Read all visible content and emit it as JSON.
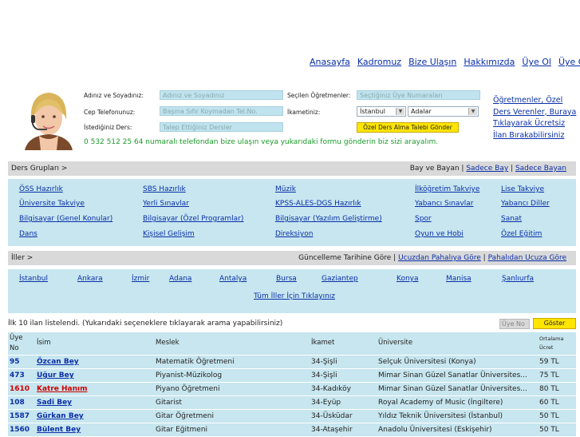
{
  "nav": [
    "Anasayfa",
    "Kadromuz",
    "Bize Ulaşın",
    "Hakkımızda",
    "Üye Ol",
    "Üye Girişi"
  ],
  "form": {
    "name_label": "Adınız ve Soyadınız:",
    "name_placeholder": "Adınız ve Soyadınız",
    "phone_label": "Cep Telefonunuz:",
    "phone_placeholder": "Başına Sıfır Koymadan Tel.No.",
    "lesson_label": "İstediğiniz Ders:",
    "lesson_placeholder": "Talep Ettiğiniz Dersler",
    "teachers_label": "Seçilen Öğretmenler:",
    "teachers_placeholder": "Seçtiğiniz Üye Numaraları",
    "residence_label": "İkametiniz:",
    "city": "İstanbul",
    "district": "Adalar",
    "submit": "Özel Ders Alma Talebi Gönder",
    "phone_note": "0 532 512 25 64 numaralı telefondan bize ulaşın veya yukarıdaki formu gönderin biz sizi arayalım."
  },
  "sidelink": "Öğretmenler, Özel Ders Verenler, Buraya Tıklayarak Ücretsiz İlan Bırakabilirsiniz",
  "groups": {
    "title": "Ders Grupları >",
    "filter_prefix": "Bay ve Bayan |",
    "filter_male": "Sadece Bay",
    "filter_sep": " | ",
    "filter_female": "Sadece Bayan",
    "items": [
      "ÖSS Hazırlık",
      "SBS Hazırlık",
      "Müzik",
      "İlköğretim Takviye",
      "Lise Takviye",
      "Üniversite Takviye",
      "Yerli Sınavlar",
      "KPSS-ALES-DGS Hazırlık",
      "Yabancı Sınavlar",
      "Yabancı Diller",
      "Bilgisayar (Genel Konular)",
      "Bilgisayar (Özel Programlar)",
      "Bilgisayar (Yazılım Geliştirme)",
      "Spor",
      "Sanat",
      "Dans",
      "Kişisel Gelişim",
      "Direksiyon",
      "Oyun ve Hobi",
      "Özel Eğitim"
    ]
  },
  "cities": {
    "title": "İller >",
    "sort_prefix": "Güncelleme Tarihine Göre |",
    "sort_cheap": "Ucuzdan Pahalıya Göre",
    "sort_sep": " | ",
    "sort_expensive": "Pahalıdan Ucuza Göre",
    "items": [
      "İstanbul",
      "Ankara",
      "İzmir",
      "Adana",
      "Antalya",
      "Bursa",
      "Gaziantep",
      "Konya",
      "Manisa",
      "Şanlıurfa"
    ],
    "all": "Tüm İller İçin Tıklayınız"
  },
  "list": {
    "info": "İlk 10 ilan listelendi. (Yukarıdaki seçeneklere tıklayarak arama yapabilirsiniz)",
    "uye_placeholder": "Üye No",
    "show": "Göster",
    "headers": {
      "no_1": "Üye",
      "no_2": "No",
      "name": "İsim",
      "job": "Meslek",
      "res": "İkamet",
      "uni": "Üniversite",
      "fee_1": "Ortalama",
      "fee_2": "Ücret"
    },
    "rows": [
      {
        "no": "95",
        "name": "Özcan Bey",
        "job": "Matematik Öğretmeni",
        "res": "34-Şişli",
        "uni": "Selçuk Üniversitesi (Konya)",
        "fee": "59 TL",
        "red": false
      },
      {
        "no": "473",
        "name": "Uğur Bey",
        "job": "Piyanist-Müzikolog",
        "res": "34-Şişli",
        "uni": "Mimar Sinan Güzel Sanatlar Üniversites...",
        "fee": "75 TL",
        "red": false
      },
      {
        "no": "1610",
        "name": "Katre Hanım",
        "job": "Piyano Öğretmeni",
        "res": "34-Kadıköy",
        "uni": "Mimar Sinan Güzel Sanatlar Üniversites...",
        "fee": "80 TL",
        "red": true
      },
      {
        "no": "108",
        "name": "Sadi Bey",
        "job": "Gitarist",
        "res": "34-Eyüp",
        "uni": "Royal Academy of Music (İngiltere)",
        "fee": "60 TL",
        "red": false
      },
      {
        "no": "1587",
        "name": "Gürkan Bey",
        "job": "Gitar Öğretmeni",
        "res": "34-Üsküdar",
        "uni": "Yıldız Teknik Üniversitesi (İstanbul)",
        "fee": "50 TL",
        "red": false
      },
      {
        "no": "1560",
        "name": "Bülent Bey",
        "job": "Gitar Eğitmeni",
        "res": "34-Ataşehir",
        "uni": "Anadolu Üniversitesi (Eskişehir)",
        "fee": "50 TL",
        "red": false
      }
    ]
  },
  "colors": {
    "accent_blue": "#0a2fa8",
    "panel": "#c7e6ef",
    "button": "#ffe500",
    "phone_green": "#1a9a2a",
    "alert_red": "#cc0000"
  }
}
